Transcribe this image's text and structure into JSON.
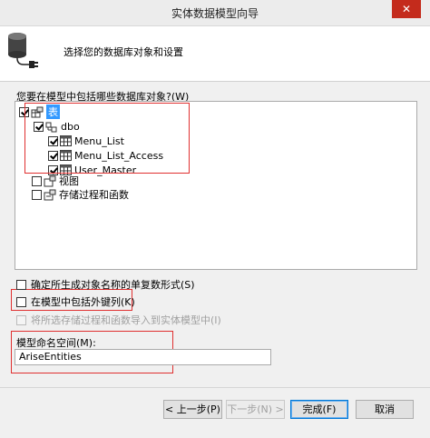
{
  "window": {
    "title": "实体数据模型向导",
    "close_glyph": "✕"
  },
  "header": {
    "text": "选择您的数据库对象和设置",
    "icon": "database-plug-icon"
  },
  "question_label": "您要在模型中包括哪些数据库对象?(W)",
  "tree": {
    "tables": {
      "label": "表",
      "checked": true
    },
    "schema": {
      "label": "dbo",
      "checked": true
    },
    "items": [
      {
        "label": "Menu_List",
        "checked": true
      },
      {
        "label": "Menu_List_Access",
        "checked": true
      },
      {
        "label": "User_Master",
        "checked": true
      }
    ],
    "views": {
      "label": "视图",
      "checked": false
    },
    "procs": {
      "label": "存储过程和函数",
      "checked": false
    }
  },
  "options": {
    "pluralize": {
      "label": "确定所生成对象名称的单复数形式(S)",
      "checked": false,
      "enabled": true
    },
    "foreign_keys": {
      "label": "在模型中包括外键列(K)",
      "checked": false,
      "enabled": true
    },
    "import_procs": {
      "label": "将所选存储过程和函数导入到实体模型中(I)",
      "checked": false,
      "enabled": false
    }
  },
  "namespace": {
    "label": "模型命名空间(M):",
    "value": "AriseEntities"
  },
  "buttons": {
    "previous": "< 上一步(P)",
    "next": "下一步(N) >",
    "finish": "完成(F)",
    "cancel": "取消"
  },
  "colors": {
    "highlight": "#3399ff",
    "annotation": "#e03030",
    "close": "#c42b1c"
  }
}
